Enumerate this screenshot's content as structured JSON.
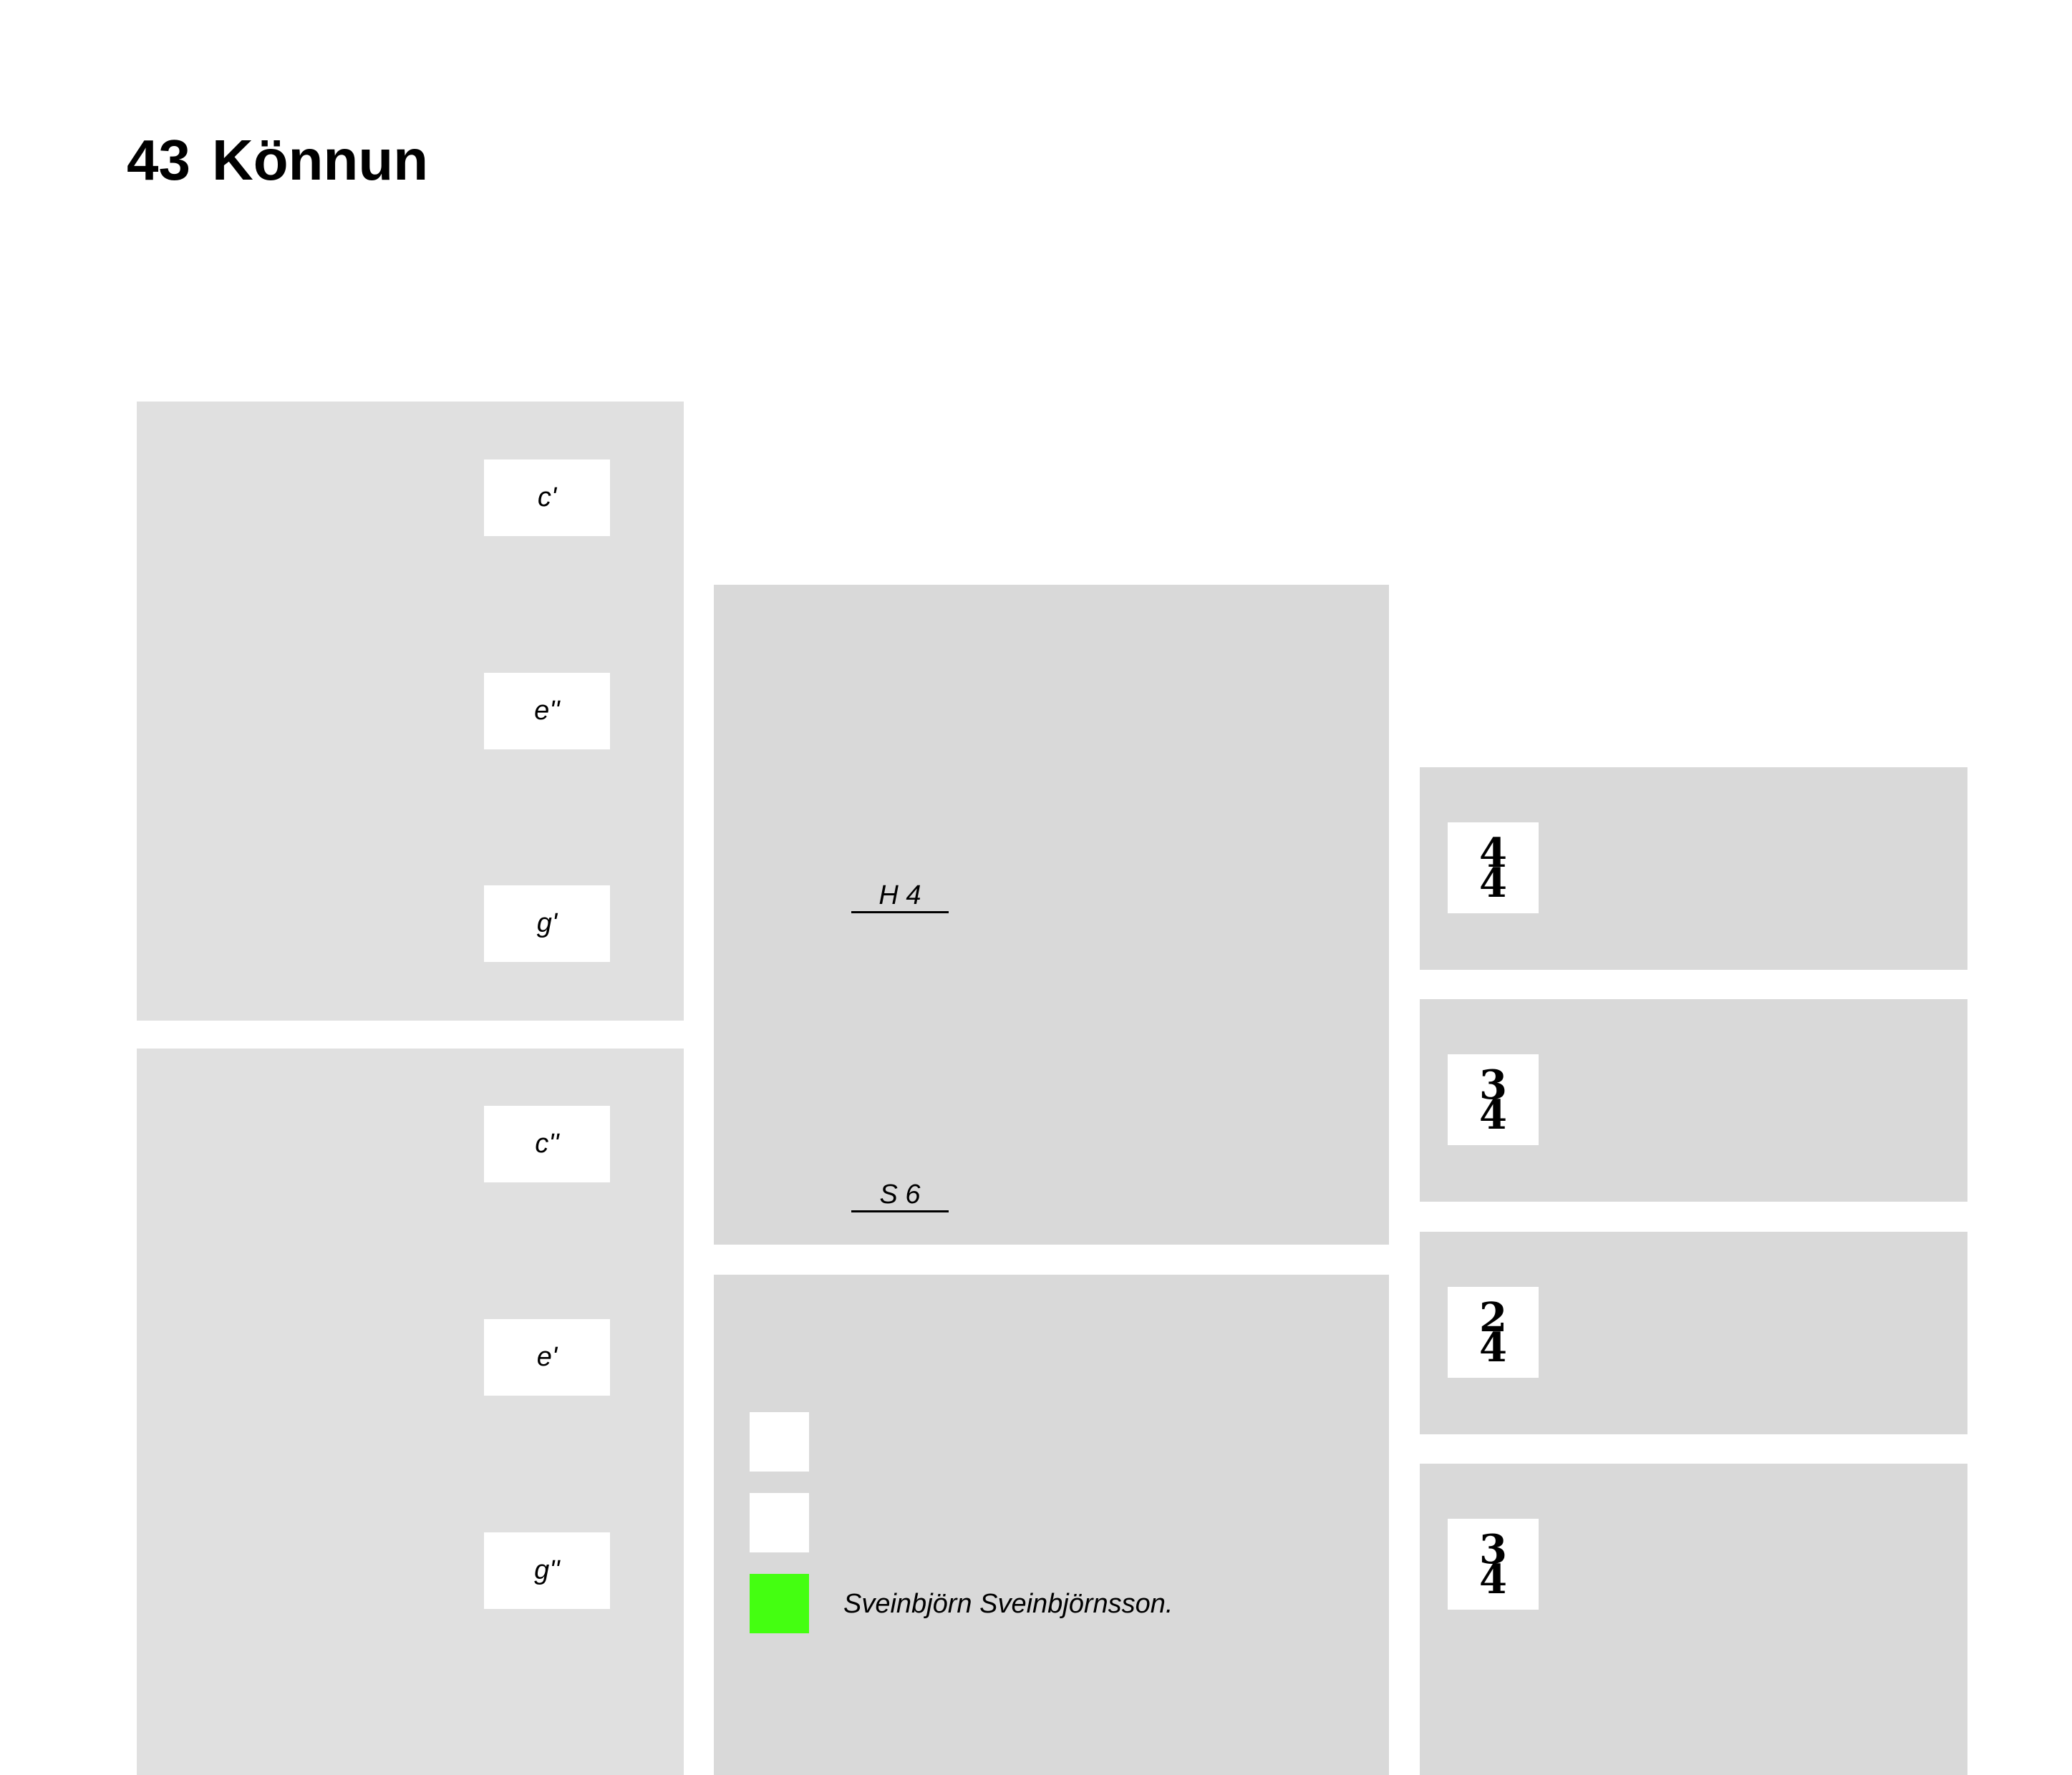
{
  "header": {
    "number": "43",
    "title": "Könnun"
  },
  "pitch_panels": [
    {
      "notes": [
        "c'",
        "e''",
        "g'"
      ]
    },
    {
      "notes": [
        "c''",
        "e'",
        "g''"
      ]
    }
  ],
  "range_panel": {
    "markers": [
      "H 4",
      "S 6"
    ]
  },
  "legend_panel": {
    "composer": "Sveinbjörn Sveinbjörnsson.",
    "colors": {
      "empty": "#ffffff",
      "selected": "#44ff11"
    }
  },
  "time_signatures": [
    {
      "top": "4",
      "bottom": "4"
    },
    {
      "top": "3",
      "bottom": "4"
    },
    {
      "top": "2",
      "bottom": "4"
    },
    {
      "top": "3",
      "bottom": "4"
    }
  ]
}
